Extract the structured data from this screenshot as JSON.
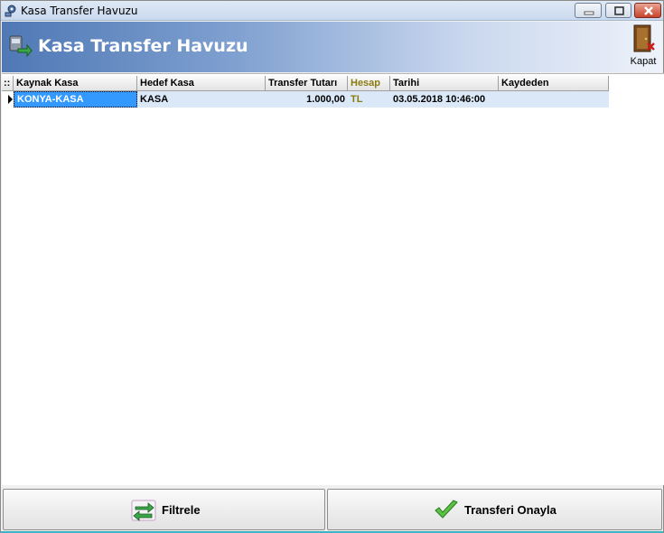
{
  "window": {
    "title": "Kasa Transfer Havuzu"
  },
  "banner": {
    "title": "Kasa Transfer Havuzu",
    "close_label": "Kapat"
  },
  "grid": {
    "columns": [
      "Kaynak Kasa",
      "Hedef Kasa",
      "Transfer Tutarı",
      "Hesap",
      "Tarihi",
      "Kaydeden"
    ],
    "rows": [
      {
        "kaynak": "KONYA-KASA",
        "hedef": "KASA",
        "tutar": "1.000,00",
        "hesap": "TL",
        "tarih": "03.05.2018 10:46:00",
        "kaydeden": ""
      }
    ],
    "indicator": "::"
  },
  "buttons": {
    "filter_label": "Filtrele",
    "approve_label": "Transferi Onayla"
  },
  "colors": {
    "banner": "#4f78b5",
    "selection": "#3399ff",
    "row_bg": "#dbe8f8",
    "hesap_text": "#8a7a10"
  }
}
